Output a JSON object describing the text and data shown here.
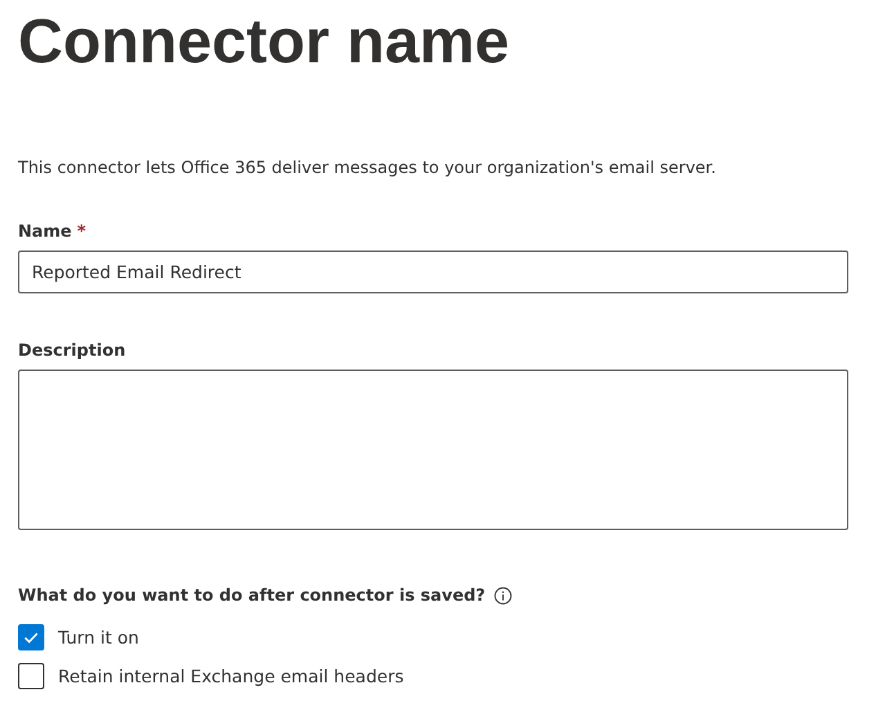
{
  "title": "Connector name",
  "intro": "This connector lets Office 365 deliver messages to your organization's email server.",
  "fields": [
    {
      "kind": "input",
      "label": "Name",
      "required_mark": "*",
      "value": "Reported Email Redirect"
    },
    {
      "kind": "textarea",
      "label": "Description"
    }
  ],
  "question": {
    "label": "What do you want to do after connector is saved?",
    "info": true
  },
  "options": [
    {
      "label": "Turn it on",
      "checked": true
    },
    {
      "label": "Retain internal Exchange email headers",
      "checked": false
    }
  ]
}
